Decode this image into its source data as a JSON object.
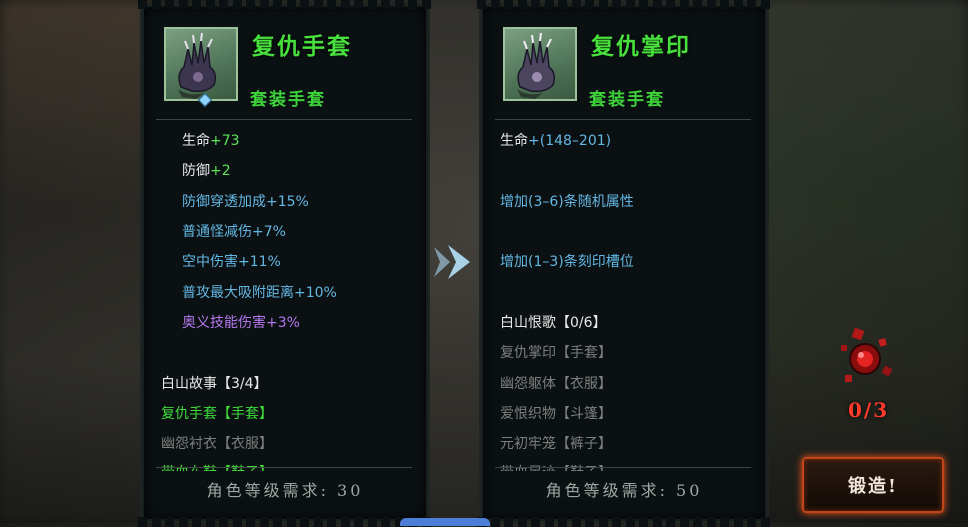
{
  "left_item": {
    "name": "复仇手套",
    "type": "套装手套",
    "stats": [
      {
        "label": "生命",
        "value": "+73",
        "label_color": "white"
      },
      {
        "label": "防御",
        "value": "+2",
        "label_color": "white"
      },
      {
        "label": "防御穿透加成",
        "value": "+15%",
        "label_color": "blue"
      },
      {
        "label": "普通怪减伤",
        "value": "+7%",
        "label_color": "blue"
      },
      {
        "label": "空中伤害",
        "value": "+11%",
        "label_color": "blue"
      },
      {
        "label": "普攻最大吸附距离",
        "value": "+10%",
        "label_color": "blue"
      },
      {
        "label": "奥义技能伤害",
        "value": "+3%",
        "label_color": "purple"
      }
    ],
    "set_title": "白山故事【3/4】",
    "set_items": [
      {
        "text": "复仇手套【手套】",
        "state": "owned"
      },
      {
        "text": "幽怨衬衣【衣服】",
        "state": "missing"
      },
      {
        "text": "带血布鞋【鞋子】",
        "state": "owned"
      }
    ],
    "requirement": "角色等级需求: 30"
  },
  "right_item": {
    "name": "复仇掌印",
    "type": "套装手套",
    "stats": [
      {
        "label": "生命",
        "value": "+(148–201)"
      },
      {
        "label": "增加(3–6)条随机属性",
        "value": ""
      },
      {
        "label": "增加(1–3)条刻印槽位",
        "value": ""
      }
    ],
    "set_title": "白山恨歌【0/6】",
    "set_items": [
      {
        "text": "复仇掌印【手套】"
      },
      {
        "text": "幽怨躯体【衣服】"
      },
      {
        "text": "爱恨织物【斗篷】"
      },
      {
        "text": "元初牢笼【裤子】"
      },
      {
        "text": "带血足迹【鞋子】"
      }
    ],
    "requirement": "角色等级需求: 50"
  },
  "forge": {
    "count": "0/3",
    "button_label": "锻造!"
  },
  "colors": {
    "green": "#47e03d",
    "blue": "#63b7e4",
    "purple": "#b578f0",
    "gray": "#7b7f7d",
    "forge_red": "#ff3a2a"
  }
}
